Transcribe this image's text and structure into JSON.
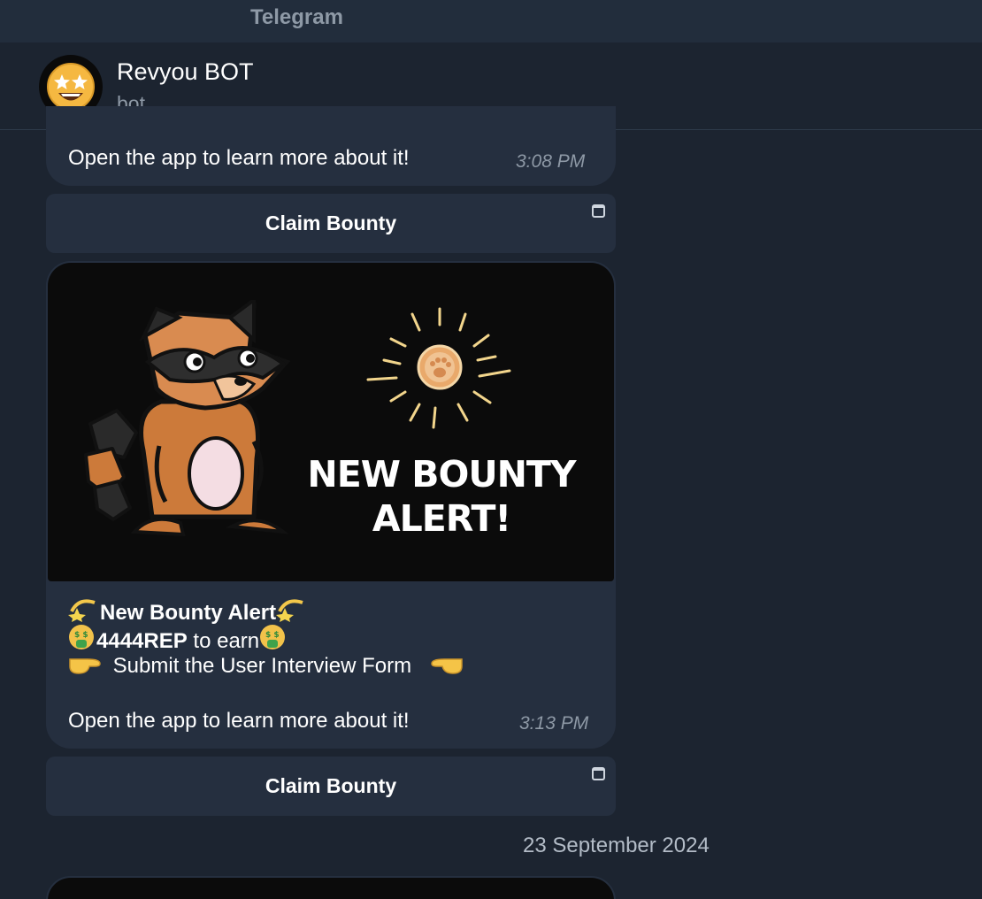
{
  "window": {
    "title": "Telegram"
  },
  "chat": {
    "name": "Revyou BOT",
    "status": "bot",
    "avatar_icon": "star-struck-emoji-icon"
  },
  "messages": [
    {
      "text_last": "Open the app to learn more about it!",
      "time": "3:08 PM",
      "button": "Claim Bounty"
    },
    {
      "image": {
        "alt_text": "NEW BOUNTY ALERT!",
        "line1": "NEW BOUNTY",
        "line2": "ALERT!",
        "icons": [
          "raccoon-mascot-icon",
          "paw-coin-icon"
        ]
      },
      "title": "New Bounty Alert",
      "reward_amount": "4444REP",
      "reward_suffix": " to earn",
      "instruction": "Submit the User Interview Form",
      "text_last": "Open the app to learn more about it!",
      "time": "3:13 PM",
      "button": "Claim Bounty"
    }
  ],
  "date_separator": "23 September 2024",
  "colors": {
    "background": "#1c2430",
    "bubble": "#252f3f",
    "muted_text": "#8e99a6"
  }
}
